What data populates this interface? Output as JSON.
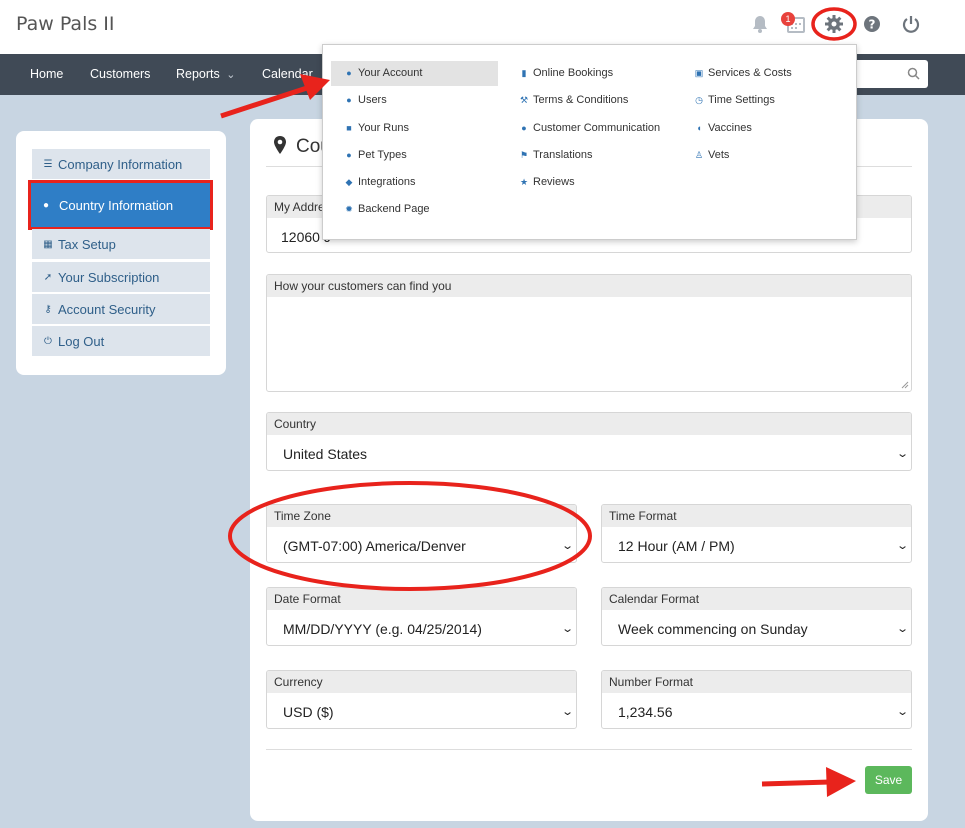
{
  "app": {
    "title": "Paw Pals II"
  },
  "header": {
    "icons": [
      "bell-icon",
      "calendar-icon",
      "gear-icon",
      "help-icon",
      "power-icon"
    ],
    "notification_count": "1"
  },
  "nav": {
    "items": [
      "Home",
      "Customers",
      "Reports",
      "Calendar"
    ],
    "reports_caret": "⌄"
  },
  "settings_menu": {
    "col1": [
      "Your Account",
      "Users",
      "Your Runs",
      "Pet Types",
      "Integrations",
      "Backend Page"
    ],
    "col2": [
      "Online Bookings",
      "Terms & Conditions",
      "Customer Communication",
      "Translations",
      "Reviews"
    ],
    "col3": [
      "Services & Costs",
      "Time Settings",
      "Vaccines",
      "Vets"
    ],
    "highlighted": "Your Account"
  },
  "sidebar": {
    "items": [
      "Company Information",
      "Country Information",
      "Tax Setup",
      "Your Subscription",
      "Account Security",
      "Log Out"
    ],
    "active": "Country Information"
  },
  "page": {
    "title_visible": "Cou",
    "fields": {
      "address": {
        "label": "My Addre",
        "value": "12060 J"
      },
      "find_you": {
        "label": "How your customers can find you",
        "value": ""
      },
      "country": {
        "label": "Country",
        "value": "United States"
      },
      "time_zone": {
        "label": "Time Zone",
        "value": "(GMT-07:00) America/Denver"
      },
      "time_format": {
        "label": "Time Format",
        "value": "12 Hour (AM / PM)"
      },
      "date_format": {
        "label": "Date Format",
        "value": "MM/DD/YYYY (e.g. 04/25/2014)"
      },
      "calendar_format": {
        "label": "Calendar Format",
        "value": "Week commencing on Sunday"
      },
      "currency": {
        "label": "Currency",
        "value": "USD ($)"
      },
      "number_format": {
        "label": "Number Format",
        "value": "1,234.56"
      }
    },
    "save_label": "Save"
  },
  "colors": {
    "nav_bg": "#404a56",
    "active_blue": "#2f7ec6",
    "save_green": "#5cb85c",
    "annotation_red": "#e8231c"
  }
}
